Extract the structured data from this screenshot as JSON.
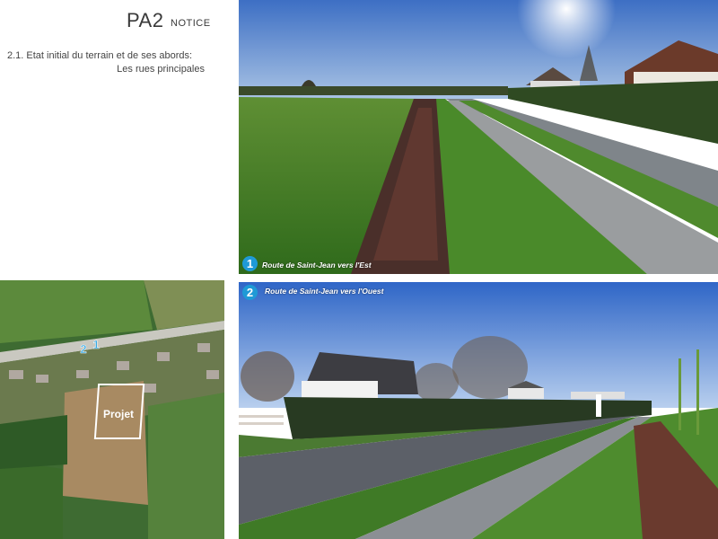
{
  "header": {
    "code": "PA2",
    "notice": "NOTICE",
    "section_title": "2.1. Etat initial du terrain et de ses abords:",
    "section_subtitle": "Les rues principales"
  },
  "photos": [
    {
      "number": "1",
      "caption": "Route de Saint-Jean vers l'Est"
    },
    {
      "number": "2",
      "caption": "Route de Saint-Jean vers l'Ouest"
    }
  ],
  "map": {
    "projet_label": "Projet",
    "marker_2": "2",
    "marker_1": "1"
  },
  "colors": {
    "badge": "#1f9ad6",
    "sky": "#3a77cf",
    "grass": "#4d8a2d"
  }
}
